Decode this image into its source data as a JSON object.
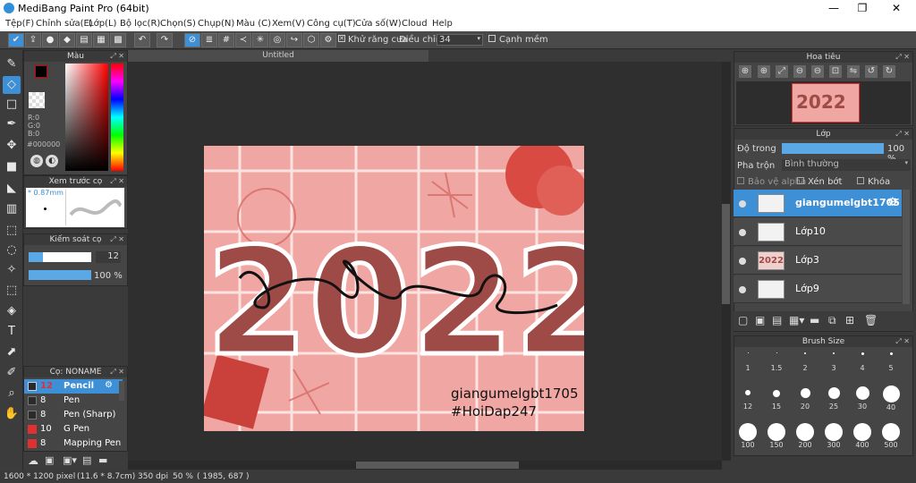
{
  "app": {
    "title": "MediBang Paint Pro (64bit)",
    "min": "—",
    "max": "❐",
    "close": "✕"
  },
  "menu": [
    "Tệp(F)",
    "Chỉnh sửa(E)",
    "Lớp(L)",
    "Bộ lọc(R)",
    "Chọn(S)",
    "Chụp(N)",
    "Màu (C)",
    "Xem(V)",
    "Công cụ(T)",
    "Cửa số(W)",
    "Cloud",
    "Help"
  ],
  "toolbar": {
    "antialias_label": "Khử răng cưa",
    "adjust_label": "Điều chỉnh",
    "adjust_value": "34",
    "edge_label": "Cạnh mềm"
  },
  "color_panel": {
    "title": "Màu",
    "r": "R:0",
    "g": "G:0",
    "b": "B:0",
    "hex": "#000000"
  },
  "brush_preview": {
    "title": "Xem trước cọ",
    "size": "* 0.87mm"
  },
  "brush_control": {
    "title": "Kiếm soát cọ",
    "size_value": "12",
    "opacity_value": "100 %"
  },
  "brush_list": {
    "title": "Cọ: NONAME",
    "items": [
      {
        "size": "12",
        "name": "Pencil",
        "color": "#2a2a2a",
        "selected": true
      },
      {
        "size": "8",
        "name": "Pen",
        "color": "#2a2a2a"
      },
      {
        "size": "8",
        "name": "Pen (Sharp)",
        "color": "#2a2a2a"
      },
      {
        "size": "10",
        "name": "G Pen",
        "color": "#e03030"
      },
      {
        "size": "8",
        "name": "Mapping Pen",
        "color": "#e03030"
      }
    ]
  },
  "document": {
    "tab": "Untitled",
    "year": "2022",
    "sig1": "giangumelgbt1705",
    "sig2": "#HoiDap247"
  },
  "navigator": {
    "title": "Hoa tiêu"
  },
  "layer_panel": {
    "title": "Lớp",
    "opacity_label": "Độ trong",
    "opacity_value": "100 %",
    "blend_label": "Pha trộn",
    "blend_value": "Bình thường",
    "alpha_label": "Bảo vệ alpha",
    "clip_label": "Xén bớt",
    "lock_label": "Khóa",
    "layers": [
      {
        "name": "giangumelgbt1705",
        "selected": true
      },
      {
        "name": "Lớp10"
      },
      {
        "name": "Lớp3"
      },
      {
        "name": "Lớp9"
      }
    ]
  },
  "brush_size": {
    "title": "Brush Size",
    "sizes": [
      "1",
      "1.5",
      "2",
      "3",
      "4",
      "5",
      "12",
      "15",
      "20",
      "25",
      "30",
      "40",
      "100",
      "150",
      "200",
      "300",
      "400",
      "500"
    ]
  },
  "status": {
    "pixels": "1600 * 1200 pixel",
    "cm": "(11.6 * 8.7cm)",
    "dpi": "350 dpi",
    "zoom": "50 %",
    "coords": "( 1985, 687 )"
  }
}
